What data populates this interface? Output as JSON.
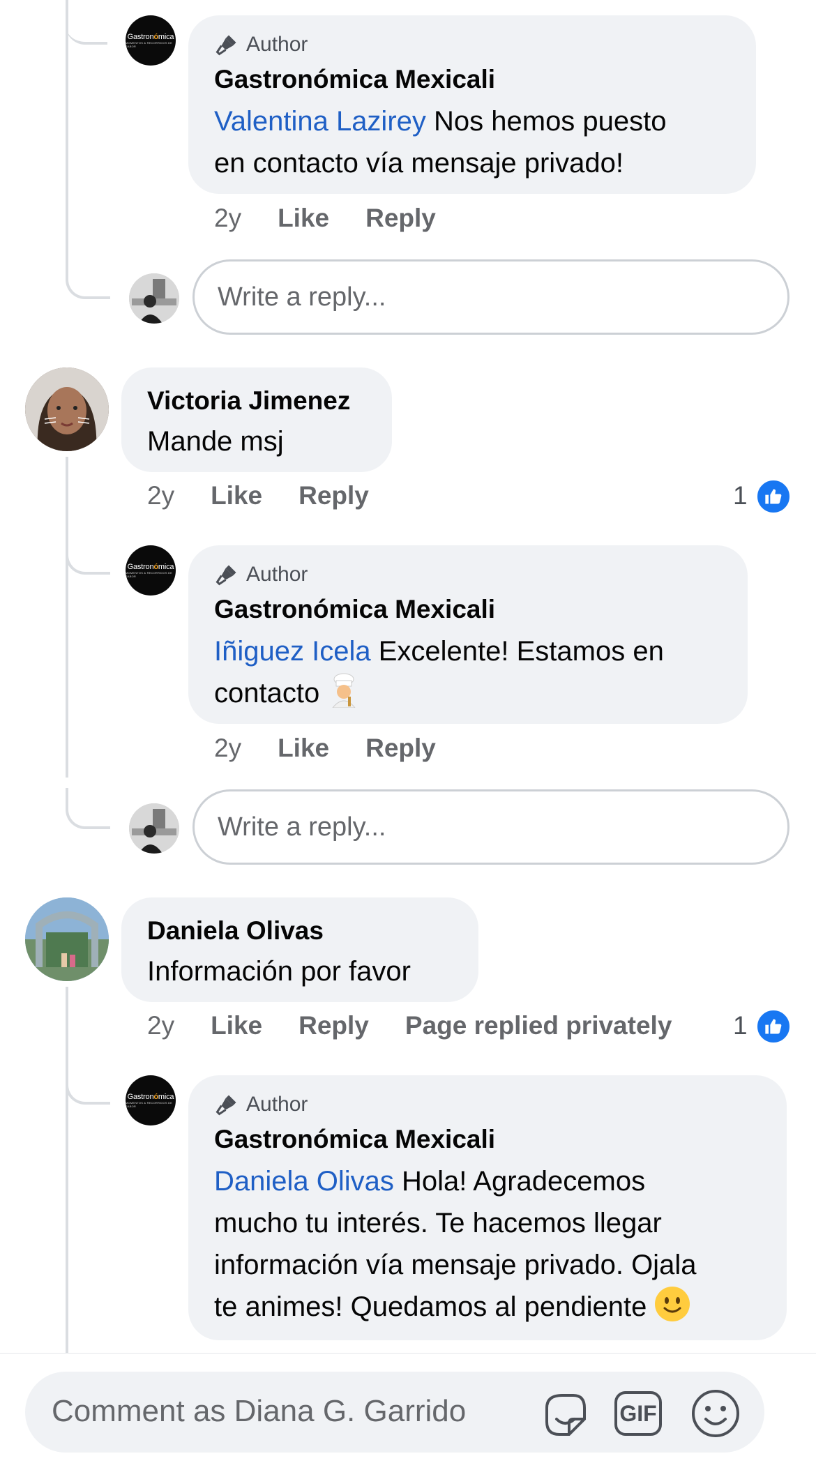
{
  "author_badge": "Author",
  "reply_placeholder": "Write a reply...",
  "page_avatar": {
    "brand_pre": "Gastron",
    "brand_o": "ó",
    "brand_post": "mica",
    "tagline": "MOMENTOS & RECORRIDOS DE SABOR"
  },
  "comments": [
    {
      "id": "r1",
      "author": "Gastronómica Mexicali",
      "mention": "Valentina Lazirey",
      "text_line1": " Nos hemos puesto",
      "text_line2": "en contacto vía mensaje privado!",
      "time": "2y",
      "like": "Like",
      "reply": "Reply"
    },
    {
      "id": "c1",
      "author": "Victoria Jimenez",
      "text": "Mande msj",
      "time": "2y",
      "like": "Like",
      "reply": "Reply",
      "reaction_count": "1"
    },
    {
      "id": "r2",
      "author": "Gastronómica Mexicali",
      "mention": "Iñiguez Icela",
      "text_line1": " Excelente! Estamos en",
      "text_line2": "contacto",
      "time": "2y",
      "like": "Like",
      "reply": "Reply"
    },
    {
      "id": "c2",
      "author": "Daniela Olivas",
      "text": "Información por favor",
      "time": "2y",
      "like": "Like",
      "reply": "Reply",
      "private_note": "Page replied privately",
      "reaction_count": "1"
    },
    {
      "id": "r3",
      "author": "Gastronómica Mexicali",
      "mention": "Daniela Olivas",
      "text_line1": " Hola! Agradecemos",
      "text_line2": "mucho tu interés. Te hacemos llegar",
      "text_line3": "información vía mensaje privado. Ojala",
      "text_line4": "te animes! Quedamos al pendiente"
    }
  ],
  "bottom_bar": {
    "placeholder": "Comment as Diana G. Garrido",
    "gif_label": "GIF"
  },
  "colors": {
    "mention": "#1f5fc5",
    "like_blue": "#1877f2",
    "bubble": "#f0f2f5"
  }
}
